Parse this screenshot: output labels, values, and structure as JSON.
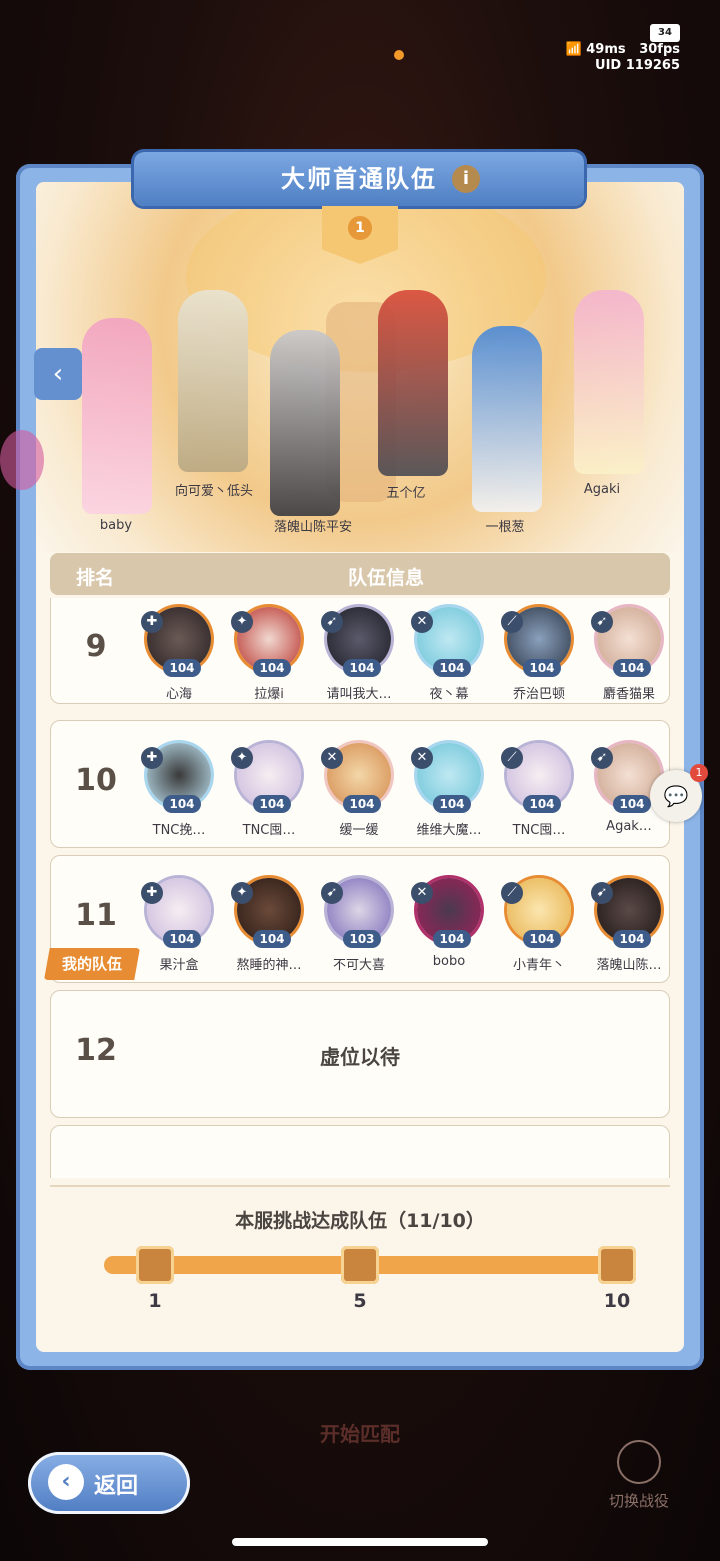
{
  "status": {
    "battery": "34",
    "ping": "49ms",
    "fps": "30fps",
    "uid": "UID 119265"
  },
  "panel_title": "大师首通队伍",
  "featured_rank": "1",
  "featured_team": [
    {
      "name": "baby"
    },
    {
      "name": "向可爱丶低头"
    },
    {
      "name": "落魄山陈平安"
    },
    {
      "name": "五个亿"
    },
    {
      "name": "一根葱"
    },
    {
      "name": "Agaki"
    }
  ],
  "table_header": {
    "rank": "排名",
    "team_info": "队伍信息"
  },
  "rows": [
    {
      "rank": "9",
      "members": [
        {
          "name": "心海",
          "level": "104",
          "icon": "sword-class-icon"
        },
        {
          "name": "拉爆i",
          "level": "104",
          "icon": "shield-class-icon"
        },
        {
          "name": "请叫我大…",
          "level": "104",
          "icon": "staff-class-icon"
        },
        {
          "name": "夜丶幕",
          "level": "104",
          "icon": "bow-class-icon"
        },
        {
          "name": "乔治巴顿",
          "level": "104",
          "icon": "blade-class-icon"
        },
        {
          "name": "麝香猫果",
          "level": "104",
          "icon": "staff-class-icon"
        }
      ]
    },
    {
      "rank": "10",
      "members": [
        {
          "name": "TNC挽…",
          "level": "104",
          "icon": "sword-class-icon"
        },
        {
          "name": "TNC囤…",
          "level": "104",
          "icon": "shield-class-icon"
        },
        {
          "name": "缓一缓",
          "level": "104",
          "icon": "bow-class-icon"
        },
        {
          "name": "维维大魔…",
          "level": "104",
          "icon": "bow-class-icon"
        },
        {
          "name": "TNC囤…",
          "level": "104",
          "icon": "blade-class-icon"
        },
        {
          "name": "Agak…",
          "level": "104",
          "icon": "staff-class-icon"
        }
      ]
    },
    {
      "rank": "11",
      "members": [
        {
          "name": "果汁盒",
          "level": "104",
          "icon": "sword-class-icon"
        },
        {
          "name": "熬睡的神…",
          "level": "104",
          "icon": "shield-class-icon"
        },
        {
          "name": "不可大喜",
          "level": "103",
          "icon": "staff-class-icon"
        },
        {
          "name": "bobo",
          "level": "104",
          "icon": "bow-class-icon"
        },
        {
          "name": "小青年丶",
          "level": "104",
          "icon": "blade-class-icon"
        },
        {
          "name": "落魄山陈…",
          "level": "104",
          "icon": "staff-class-icon"
        }
      ]
    },
    {
      "rank": "12",
      "empty_text": "虚位以待"
    }
  ],
  "my_team_label": "我的队伍",
  "progress": {
    "title": "本服挑战达成队伍（11/10）",
    "milestones": [
      "1",
      "5",
      "10"
    ],
    "fraction": 1.0
  },
  "bottom": {
    "start_label": "开始匹配",
    "back_label": "返回",
    "switch_label": "切换战役"
  },
  "chat": {
    "badge": "1"
  }
}
